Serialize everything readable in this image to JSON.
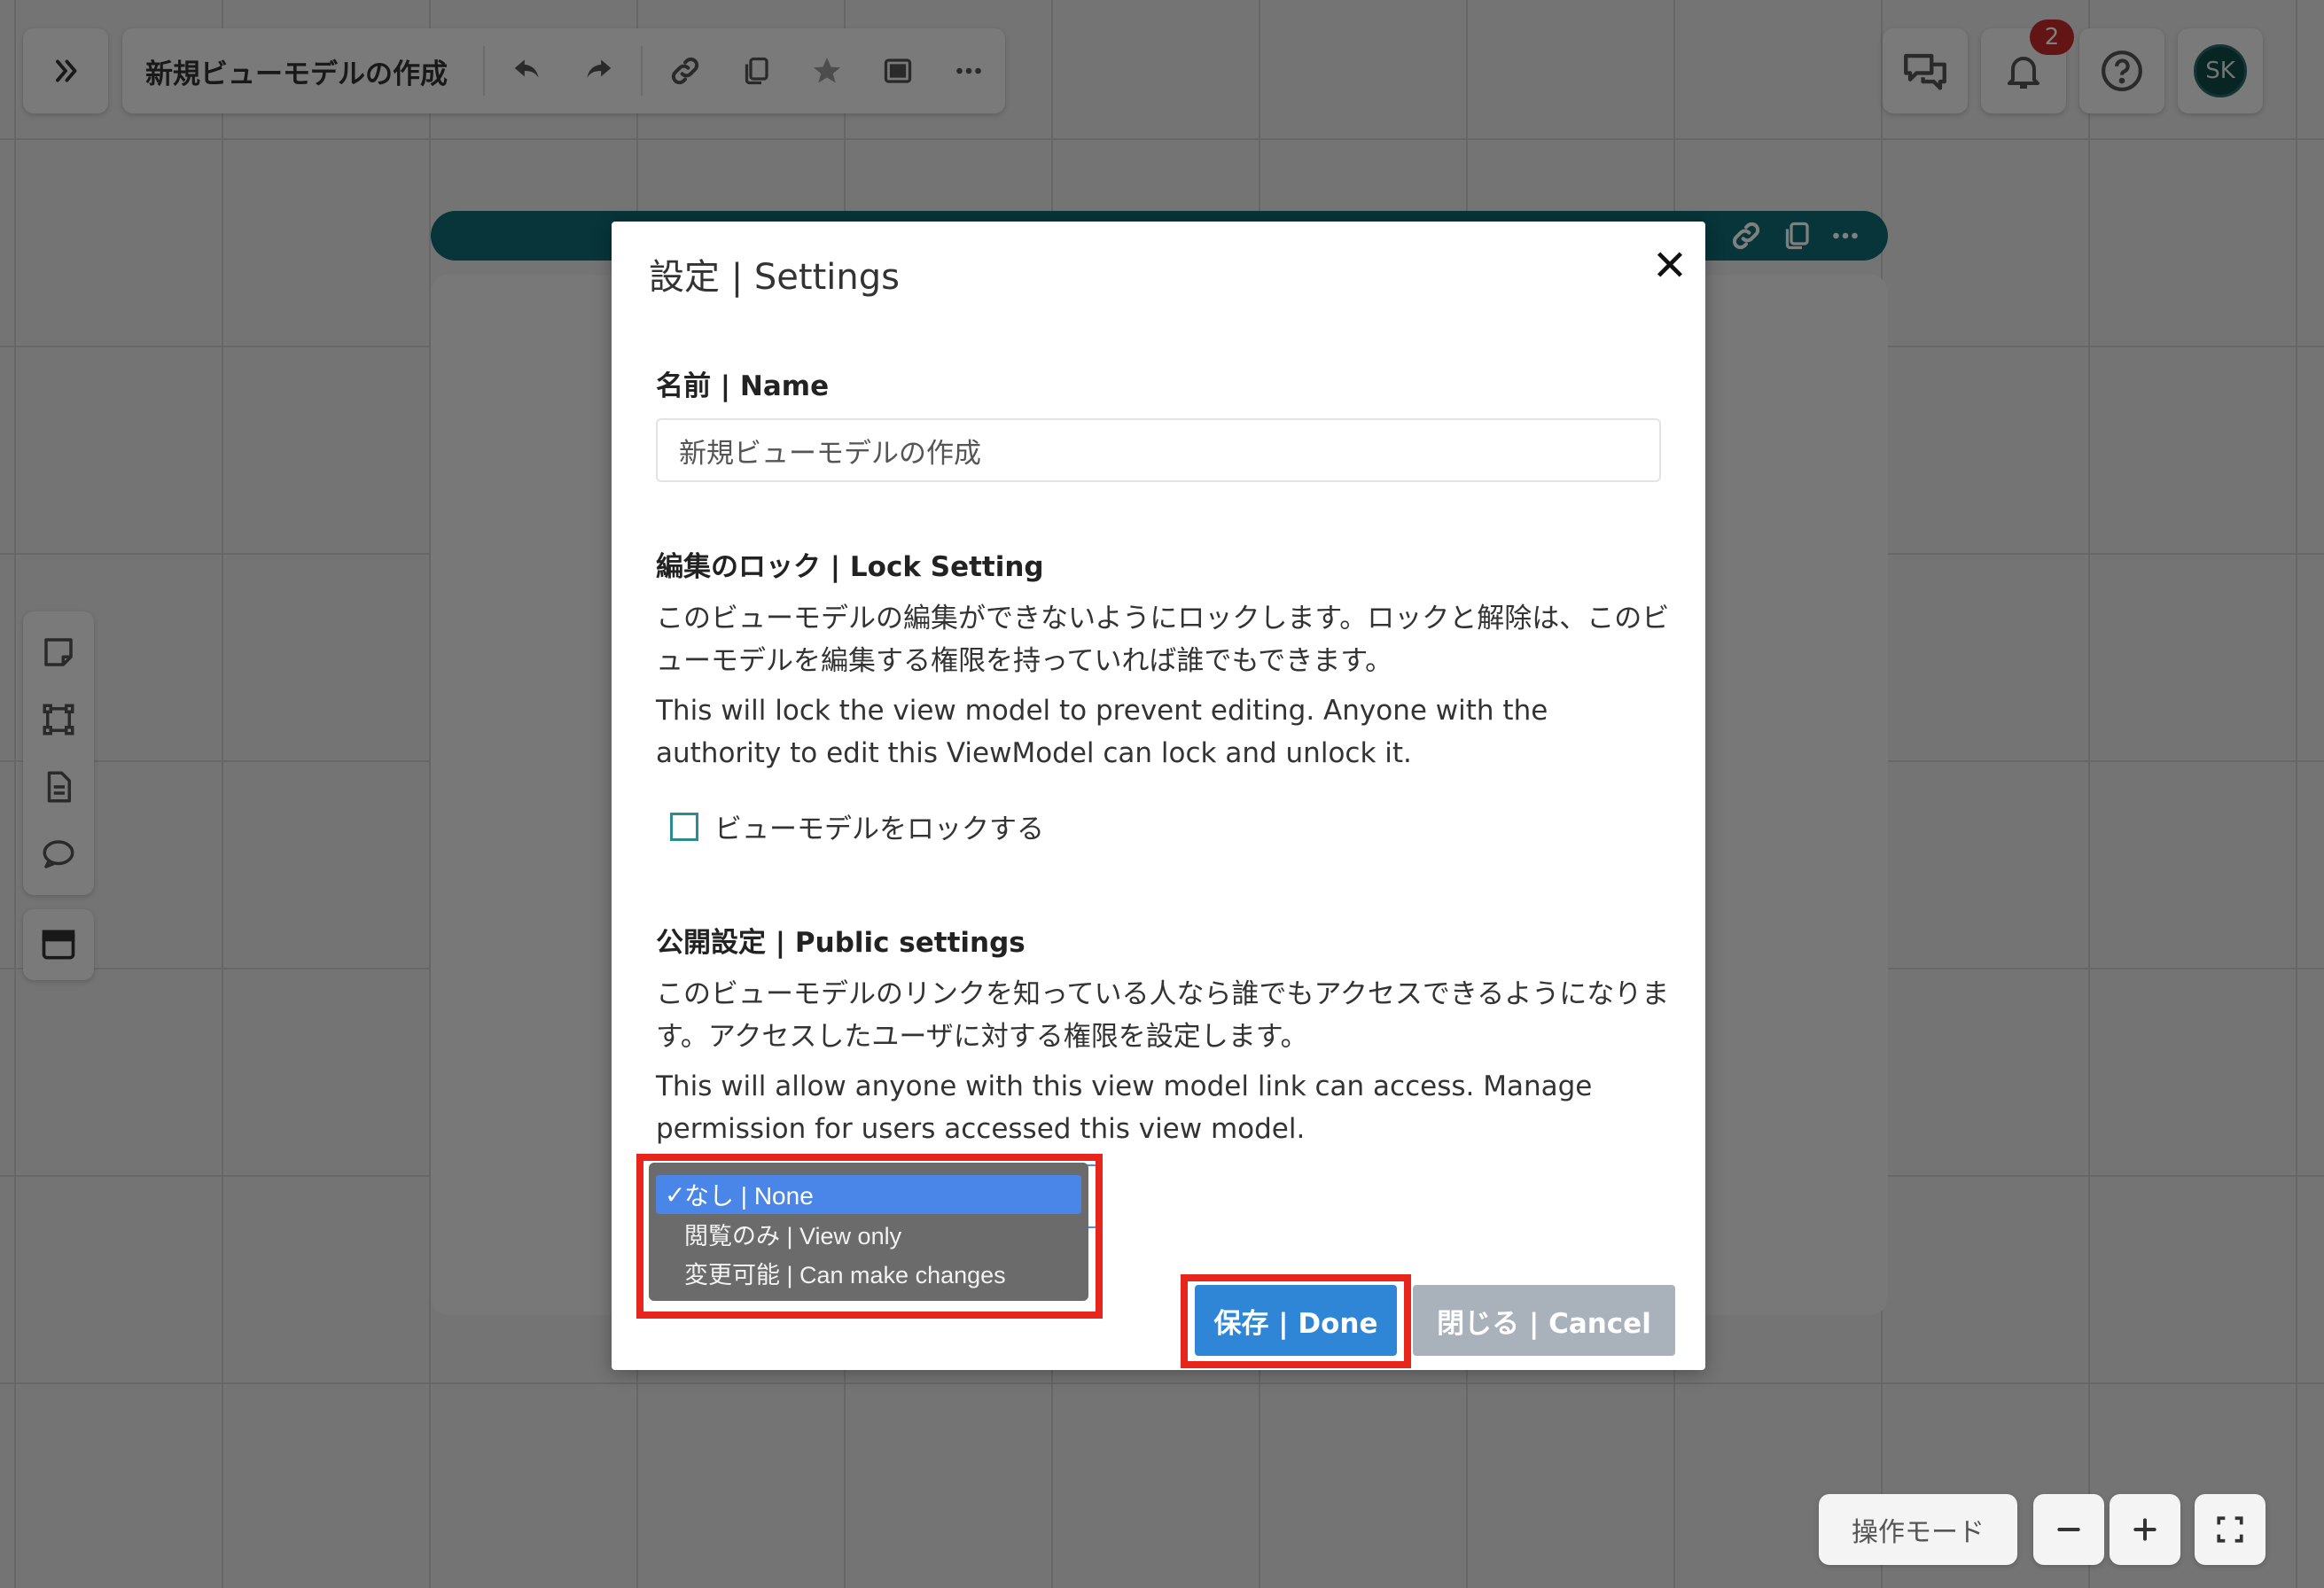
{
  "toolbar": {
    "title": "新規ビューモデルの作成",
    "icons": [
      "expand-icon",
      "undo-icon",
      "redo-icon",
      "link-icon",
      "copy-icon",
      "star-icon",
      "image-icon",
      "more-icon"
    ]
  },
  "header_right": {
    "notification_count": "2",
    "avatar_initials": "SK"
  },
  "dialog": {
    "title": "設定 | Settings",
    "name": {
      "heading": "名前 | Name",
      "value": "新規ビューモデルの作成"
    },
    "lock": {
      "heading": "編集のロック | Lock Setting",
      "description_jp": "このビューモデルの編集ができないようにロックします。ロックと解除は、このビューモデルを編集する権限を持っていれば誰でもできます。",
      "description_en": "This will lock the view model to prevent editing. Anyone with the authority to edit this ViewModel can lock and unlock it.",
      "checkbox_label": "ビューモデルをロックする",
      "checked": false
    },
    "public": {
      "heading": "公開設定 | Public settings",
      "description_jp": "このビューモデルのリンクを知っている人なら誰でもアクセスできるようになります。アクセスしたユーザに対する権限を設定します。",
      "description_en": "This will allow anyone with this view model link can access. Manage permission for users accessed this view model.",
      "options": [
        "なし | None",
        "閲覧のみ | View only",
        "変更可能 | Can make changes"
      ],
      "selected": "なし | None",
      "check_mark": "✓"
    },
    "done_label": "保存 | Done",
    "cancel_label": "閉じる | Cancel",
    "close_symbol": "✕"
  },
  "bottom_right": {
    "mode_label": "操作モード"
  },
  "colors": {
    "accent": "#0e6b73",
    "primary_button": "#2f86d6",
    "secondary_button": "#a9b1bb",
    "highlight": "#e8251b",
    "selected_option": "#4a86e8",
    "badge": "#c62828"
  }
}
